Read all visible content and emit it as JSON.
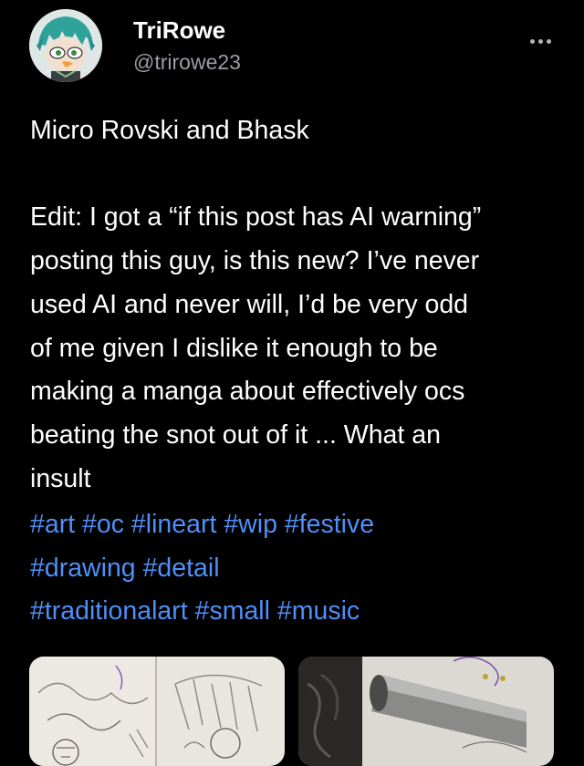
{
  "author": {
    "name": "TriRowe",
    "handle": "@trirowe23",
    "avatar_icon": "avatar-character-icon"
  },
  "post": {
    "title_line": "Micro Rovski and Bhask",
    "edit_lines": [
      "Edit: I got a “if this post has AI warning”",
      "posting this guy, is this new? I’ve never",
      "used AI and never will, I’d be very odd",
      "of me given I dislike it enough to be",
      "making a manga about effectively ocs",
      "beating the snot out of it ... What an",
      "insult"
    ],
    "tags": [
      [
        "#art",
        "#oc",
        "#lineart",
        "#wip",
        "#festive"
      ],
      [
        "#drawing",
        "#detail"
      ],
      [
        "#traditionalart",
        "#small",
        "#music"
      ]
    ]
  },
  "media": [
    {
      "icon": "sketch-image-icon"
    },
    {
      "icon": "sketch-image-icon"
    }
  ],
  "colors": {
    "background": "#000000",
    "text": "#ffffff",
    "handle": "#9a9da3",
    "tag": "#4f8ff7"
  }
}
